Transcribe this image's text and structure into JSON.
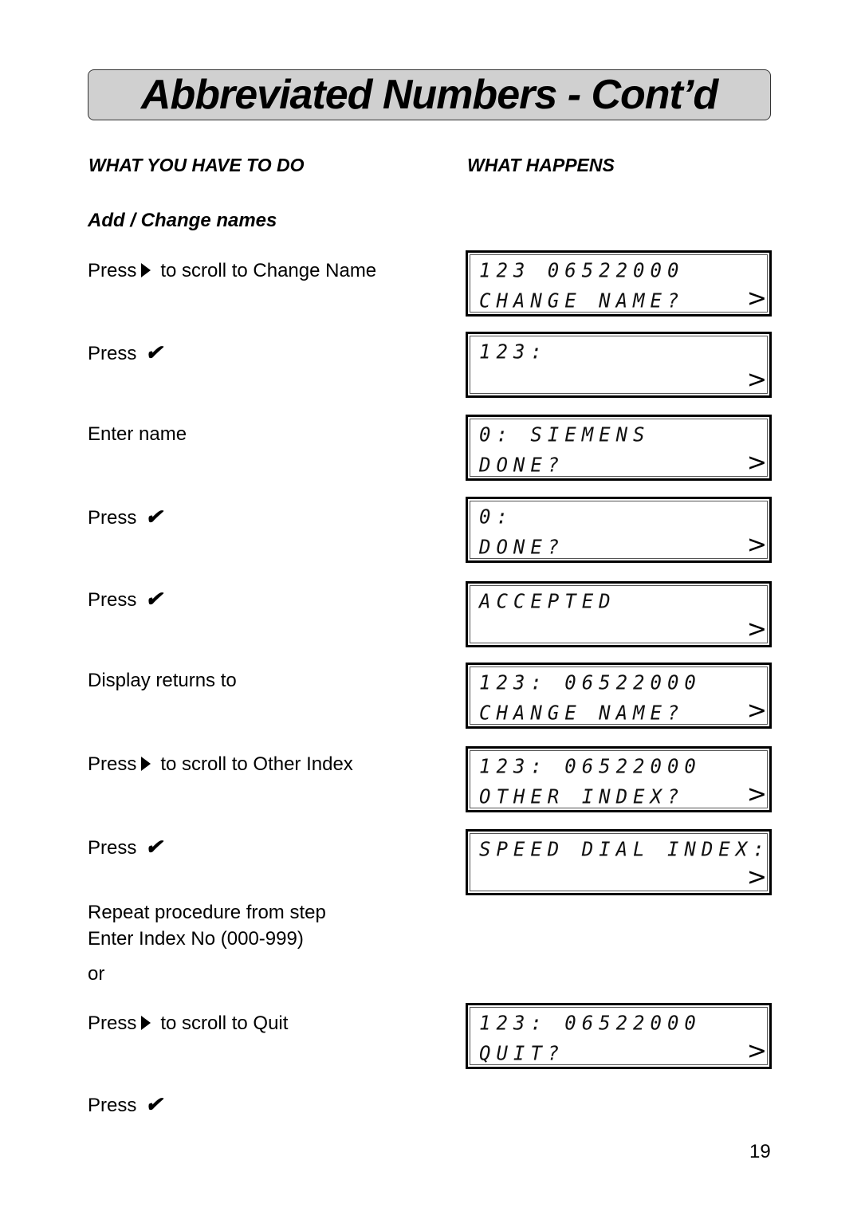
{
  "page": {
    "title": "Abbreviated Numbers - Cont’d",
    "column_left_heading": "WHAT YOU HAVE TO DO",
    "column_right_heading": "WHAT HAPPENS",
    "section_heading": "Add / Change names",
    "page_number": "19"
  },
  "icons": {
    "right_arrow": "right-triangle-icon",
    "check": "check-icon",
    "check_glyph": "✔",
    "lcd_arrow_glyph": ">"
  },
  "steps": [
    {
      "text_before": "Press",
      "icon": "right-arrow",
      "text_after": "to scroll to Change Name"
    },
    {
      "text_before": "Press",
      "icon": "check",
      "text_after": ""
    },
    {
      "text_before": "Enter name",
      "icon": "",
      "text_after": ""
    },
    {
      "text_before": "Press",
      "icon": "check",
      "text_after": ""
    },
    {
      "text_before": "Press",
      "icon": "check",
      "text_after": ""
    },
    {
      "text_before": "Display returns to",
      "icon": "",
      "text_after": ""
    },
    {
      "text_before": "Press",
      "icon": "right-arrow",
      "text_after": "to scroll to Other Index"
    },
    {
      "text_before": "Press",
      "icon": "check",
      "text_after": ""
    },
    {
      "text_line1": "Repeat procedure from step",
      "text_line2": "Enter Index No (000-999)"
    },
    {
      "text_before": "or"
    },
    {
      "text_before": "Press",
      "icon": "right-arrow",
      "text_after": "to scroll to Quit"
    },
    {
      "text_before": "Press",
      "icon": "check",
      "text_after": ""
    }
  ],
  "displays": [
    {
      "line1": "123 06522000",
      "line2": "CHANGE NAME?"
    },
    {
      "line1": "123:",
      "line2": ""
    },
    {
      "line1": "0: SIEMENS",
      "line2": "DONE?"
    },
    {
      "line1": "0:",
      "line2": "DONE?"
    },
    {
      "line1": "ACCEPTED",
      "line2": ""
    },
    {
      "line1": "123: 06522000",
      "line2": "CHANGE NAME?"
    },
    {
      "line1": "123: 06522000",
      "line2": "OTHER INDEX?"
    },
    {
      "line1": "SPEED DIAL INDEX:",
      "line2": ""
    },
    {
      "line1": "123: 06522000",
      "line2": "QUIT?"
    }
  ]
}
